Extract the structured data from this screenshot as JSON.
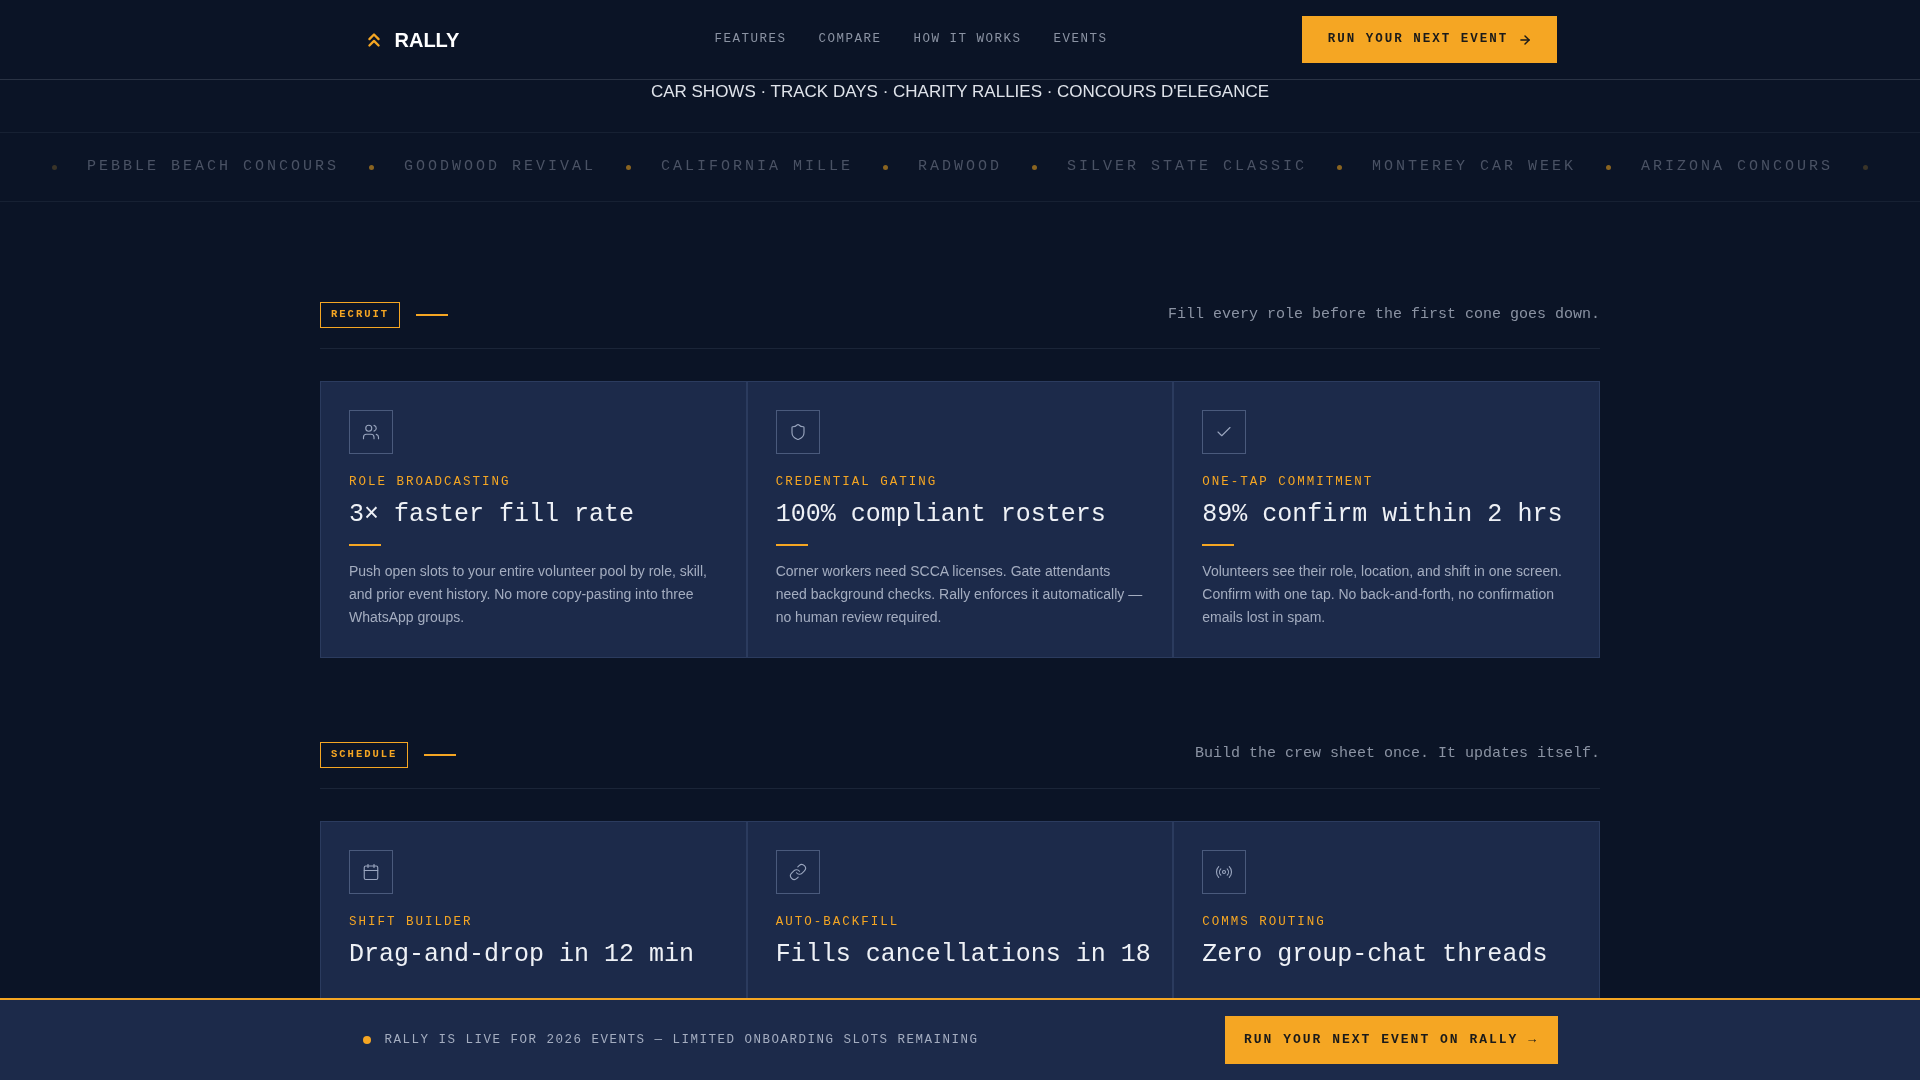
{
  "nav": {
    "brand": "RALLY",
    "links": [
      "FEATURES",
      "COMPARE",
      "HOW IT WORKS",
      "EVENTS"
    ],
    "cta": "RUN YOUR NEXT EVENT"
  },
  "hero_tagline": "CAR SHOWS · TRACK DAYS · CHARITY RALLIES · CONCOURS D'ELEGANCE",
  "ticker": [
    "PEBBLE BEACH CONCOURS",
    "GOODWOOD REVIVAL",
    "CALIFORNIA MILLE",
    "RADWOOD",
    "SILVER STATE CLASSIC",
    "MONTEREY CAR WEEK",
    "ARIZONA CONCOURS"
  ],
  "sections": [
    {
      "tag": "RECRUIT",
      "subtitle": "Fill every role before the first cone goes down.",
      "cards": [
        {
          "label": "ROLE BROADCASTING",
          "title": "3× faster fill rate",
          "text": "Push open slots to your entire volunteer pool by role, skill, and prior event history. No more copy-pasting into three WhatsApp groups."
        },
        {
          "label": "CREDENTIAL GATING",
          "title": "100% compliant rosters",
          "text": "Corner workers need SCCA licenses. Gate attendants need background checks. Rally enforces it automatically — no human review required."
        },
        {
          "label": "ONE-TAP COMMITMENT",
          "title": "89% confirm within 2 hrs",
          "text": "Volunteers see their role, location, and shift in one screen. Confirm with one tap. No back-and-forth, no confirmation emails lost in spam."
        }
      ]
    },
    {
      "tag": "SCHEDULE",
      "subtitle": "Build the crew sheet once. It updates itself.",
      "cards": [
        {
          "label": "SHIFT BUILDER",
          "title": "Drag-and-drop in 12 min"
        },
        {
          "label": "AUTO-BACKFILL",
          "title": "Fills cancellations in 18"
        },
        {
          "label": "COMMS ROUTING",
          "title": "Zero group-chat threads"
        }
      ]
    }
  ],
  "banner": {
    "text": "RALLY IS LIVE FOR 2026 EVENTS — LIMITED ONBOARDING SLOTS REMAINING",
    "cta": "RUN YOUR NEXT EVENT ON RALLY →"
  }
}
